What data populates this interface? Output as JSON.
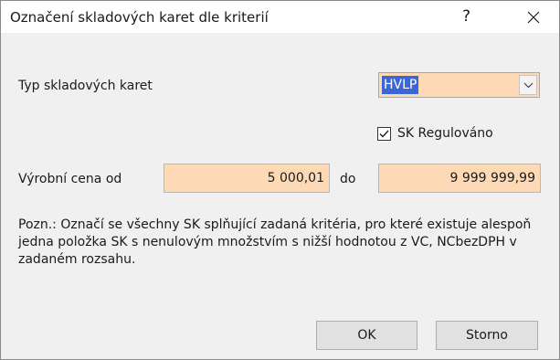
{
  "window": {
    "title": "Označení skladových karet dle kriterií",
    "help": "?"
  },
  "card_type": {
    "label": "Typ skladových karet",
    "value": "HVLP"
  },
  "regulated": {
    "label": "SK Regulováno",
    "checked": true
  },
  "price": {
    "label": "Výrobní cena od",
    "from": "5 000,01",
    "to_label": "do",
    "to": "9 999 999,99"
  },
  "note": "Pozn.: Označí se všechny SK splňující zadaná kritéria, pro které existuje alespoň jedna položka SK s nenulovým množstvím s nižší hodnotou z VC, NCbezDPH v zadaném rozsahu.",
  "buttons": {
    "ok": "OK",
    "cancel": "Storno"
  }
}
